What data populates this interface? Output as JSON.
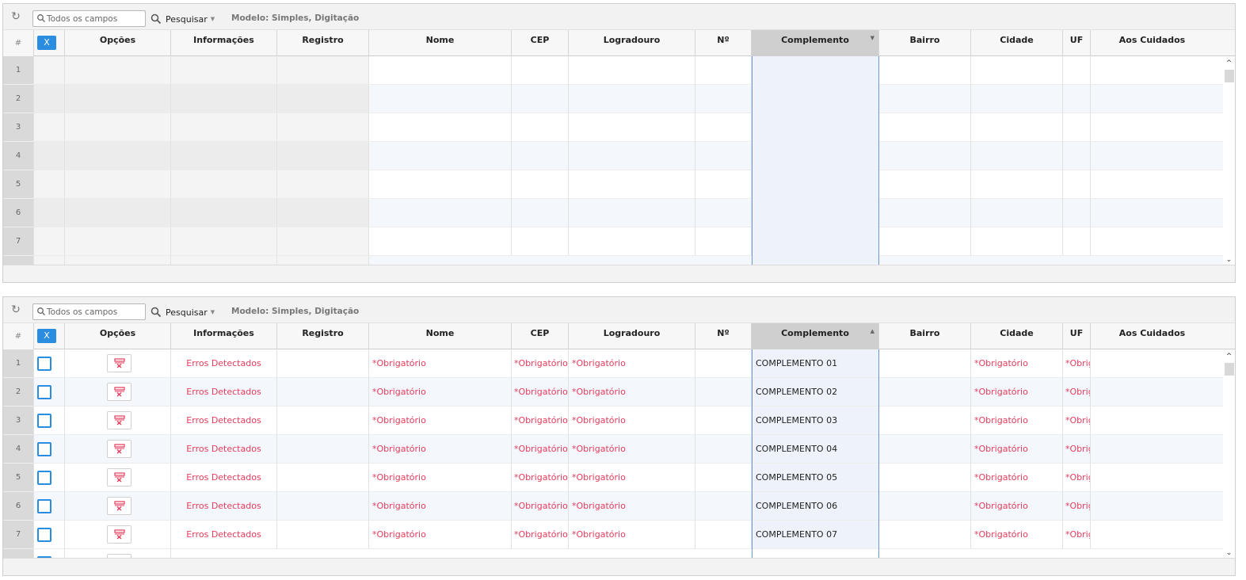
{
  "grids": [
    {
      "toolbar": {
        "search_placeholder": "Todos os campos",
        "search_button": "Pesquisar",
        "model_label": "Modelo: Simples, Digitação"
      },
      "header": {
        "hash": "#",
        "clear_button": "X",
        "columns": [
          "Opções",
          "Informações",
          "Registro",
          "Nome",
          "CEP",
          "Logradouro",
          "Nº",
          "Complemento",
          "Bairro",
          "Cidade",
          "UF",
          "Aos Cuidados"
        ],
        "sort_indicator": "▼"
      },
      "rows": [
        {
          "num": "1"
        },
        {
          "num": "2"
        },
        {
          "num": "3"
        },
        {
          "num": "4"
        },
        {
          "num": "5"
        },
        {
          "num": "6"
        },
        {
          "num": "7"
        }
      ]
    },
    {
      "toolbar": {
        "search_placeholder": "Todos os campos",
        "search_button": "Pesquisar",
        "model_label": "Modelo: Simples, Digitação"
      },
      "header": {
        "hash": "#",
        "clear_button": "X",
        "columns": [
          "Opções",
          "Informações",
          "Registro",
          "Nome",
          "CEP",
          "Logradouro",
          "Nº",
          "Complemento",
          "Bairro",
          "Cidade",
          "UF",
          "Aos Cuidados"
        ],
        "sort_indicator": "▲"
      },
      "rows": [
        {
          "num": "1",
          "info": "Erros Detectados",
          "nome": "*Obrigatório",
          "cep": "*Obrigatório",
          "logradouro": "*Obrigatório",
          "complemento": "COMPLEMENTO 01",
          "cidade": "*Obrigatório",
          "uf": "*Obrigatório"
        },
        {
          "num": "2",
          "info": "Erros Detectados",
          "nome": "*Obrigatório",
          "cep": "*Obrigatório",
          "logradouro": "*Obrigatório",
          "complemento": "COMPLEMENTO 02",
          "cidade": "*Obrigatório",
          "uf": "*Obrigatório"
        },
        {
          "num": "3",
          "info": "Erros Detectados",
          "nome": "*Obrigatório",
          "cep": "*Obrigatório",
          "logradouro": "*Obrigatório",
          "complemento": "COMPLEMENTO 03",
          "cidade": "*Obrigatório",
          "uf": "*Obrigatório"
        },
        {
          "num": "4",
          "info": "Erros Detectados",
          "nome": "*Obrigatório",
          "cep": "*Obrigatório",
          "logradouro": "*Obrigatório",
          "complemento": "COMPLEMENTO 04",
          "cidade": "*Obrigatório",
          "uf": "*Obrigatório"
        },
        {
          "num": "5",
          "info": "Erros Detectados",
          "nome": "*Obrigatório",
          "cep": "*Obrigatório",
          "logradouro": "*Obrigatório",
          "complemento": "COMPLEMENTO 05",
          "cidade": "*Obrigatório",
          "uf": "*Obrigatório"
        },
        {
          "num": "6",
          "info": "Erros Detectados",
          "nome": "*Obrigatório",
          "cep": "*Obrigatório",
          "logradouro": "*Obrigatório",
          "complemento": "COMPLEMENTO 06",
          "cidade": "*Obrigatório",
          "uf": "*Obrigatório"
        },
        {
          "num": "7",
          "info": "Erros Detectados",
          "nome": "*Obrigatório",
          "cep": "*Obrigatório",
          "logradouro": "*Obrigatório",
          "complemento": "COMPLEMENTO 07",
          "cidade": "*Obrigatório",
          "uf": "*Obrigatório"
        }
      ]
    }
  ],
  "icons": {
    "refresh": "refresh-icon",
    "search_small": "search-icon",
    "search_button": "magnifier-icon",
    "dropdown": "caret-down-icon",
    "options": "delete-row-icon",
    "scroll_up": "chevron-up-icon",
    "scroll_down": "chevron-down-icon"
  },
  "colors": {
    "accent": "#2b8de0",
    "error": "#e43b5c",
    "selected_column": "#eef3fb",
    "sorted_header": "#cfcfcf"
  }
}
